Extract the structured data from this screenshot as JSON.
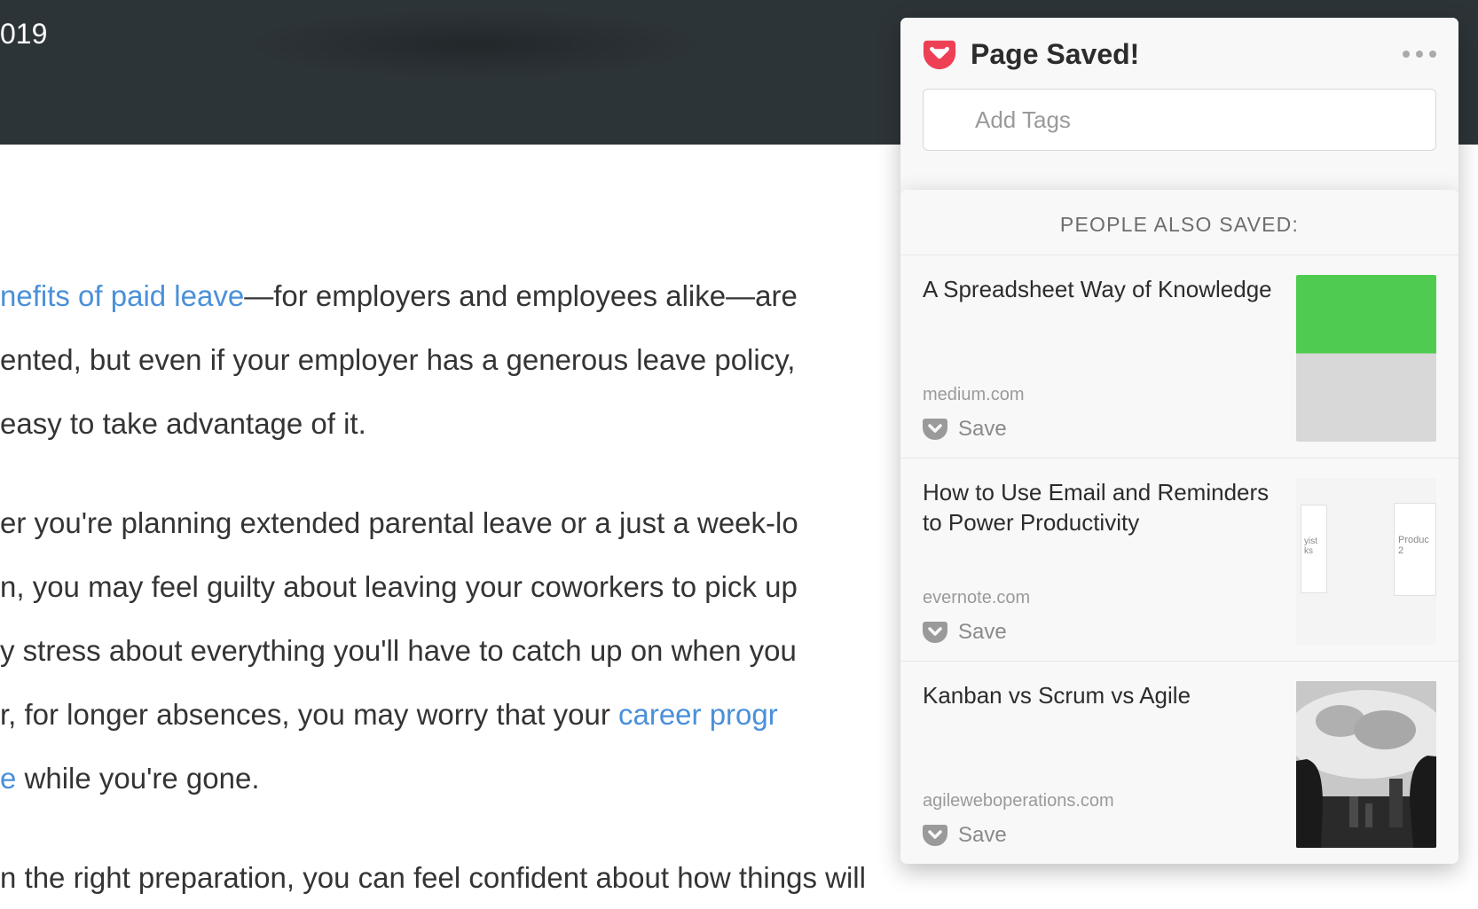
{
  "header": {
    "year_fragment": "019"
  },
  "article": {
    "link1": "nefits of paid leave",
    "p1_after_link1": "—for employers and employees alike—are",
    "p1_line2": "ented, but even if your employer has a generous leave policy,",
    "p1_line3": "easy to take advantage of it.",
    "p2_line1": "er you're planning extended parental leave or a just a week-lo",
    "p2_line2": "n, you may feel guilty about leaving your coworkers to pick up",
    "p2_line3": "y stress about everything you'll have to catch up on when you",
    "p2_line4_before_link": "r, for longer absences, you may worry that your ",
    "link2": "career progr",
    "p2_line5_link_frag": "e",
    "p2_line5_after": " while you're gone.",
    "p3_line1": "n the right preparation, you can feel confident about how things will"
  },
  "pocket": {
    "saved_title": "Page Saved!",
    "tags_placeholder": "Add Tags",
    "rec_header": "PEOPLE ALSO SAVED:",
    "items": [
      {
        "title": "A Spreadsheet Way of Knowledge",
        "source": "medium.com",
        "save_label": "Save"
      },
      {
        "title": "How to Use Email and Reminders to Power Productivity",
        "source": "evernote.com",
        "save_label": "Save",
        "thumb_cards": {
          "a": "yist\nks",
          "b": "Produc\n2"
        }
      },
      {
        "title": "Kanban vs Scrum vs Agile",
        "source": "agileweboperations.com",
        "save_label": "Save"
      }
    ]
  },
  "colors": {
    "header_bg": "#2d3438",
    "link": "#4a90d9",
    "pocket_red": "#ee4055",
    "thumb_green": "#4fcc4f"
  }
}
